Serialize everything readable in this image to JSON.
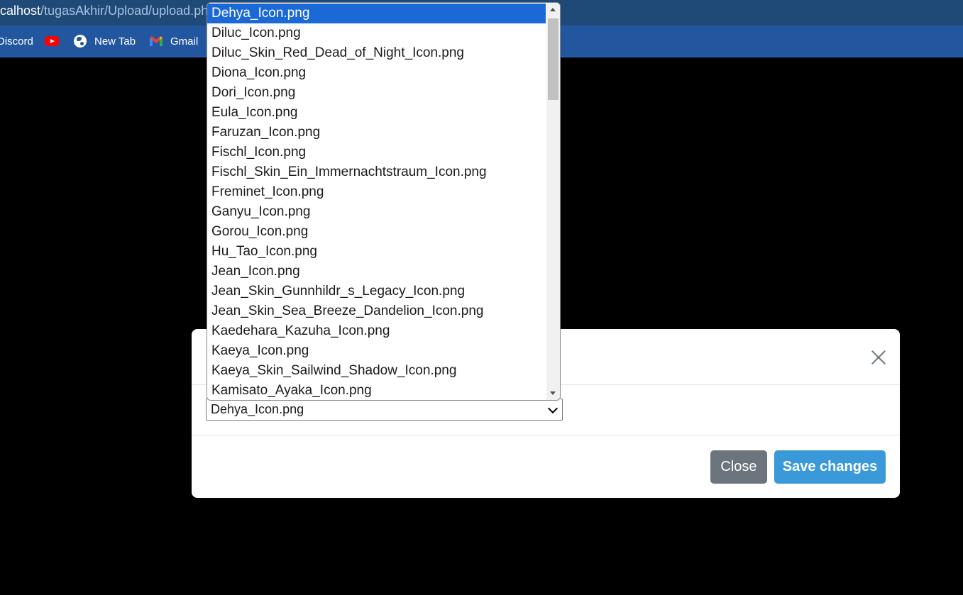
{
  "browser": {
    "url_host": "calhost",
    "url_path": "/tugasAkhir/Upload/upload.ph",
    "bookmarks": [
      {
        "label": "Discord",
        "icon": "discord-icon"
      },
      {
        "label": "",
        "icon": "youtube-icon"
      },
      {
        "label": "New Tab",
        "icon": "globe-icon"
      },
      {
        "label": "Gmail",
        "icon": "gmail-icon"
      }
    ]
  },
  "modal": {
    "select_value": "Dehya_Icon.png",
    "close_label": "Close",
    "save_label": "Save changes"
  },
  "dropdown": {
    "selected_index": 0,
    "options": [
      "Dehya_Icon.png",
      "Diluc_Icon.png",
      "Diluc_Skin_Red_Dead_of_Night_Icon.png",
      "Diona_Icon.png",
      "Dori_Icon.png",
      "Eula_Icon.png",
      "Faruzan_Icon.png",
      "Fischl_Icon.png",
      "Fischl_Skin_Ein_Immernachtstraum_Icon.png",
      "Freminet_Icon.png",
      "Ganyu_Icon.png",
      "Gorou_Icon.png",
      "Hu_Tao_Icon.png",
      "Jean_Icon.png",
      "Jean_Skin_Gunnhildr_s_Legacy_Icon.png",
      "Jean_Skin_Sea_Breeze_Dandelion_Icon.png",
      "Kaedehara_Kazuha_Icon.png",
      "Kaeya_Icon.png",
      "Kaeya_Skin_Sailwind_Shadow_Icon.png",
      "Kamisato_Ayaka_Icon.png"
    ]
  },
  "colors": {
    "address_bar": "#1f4a78",
    "bookmarks_bar": "#2257a0",
    "selected_option": "#1b69d6",
    "save_button": "#3a9ad9",
    "close_button": "#6c757d"
  }
}
